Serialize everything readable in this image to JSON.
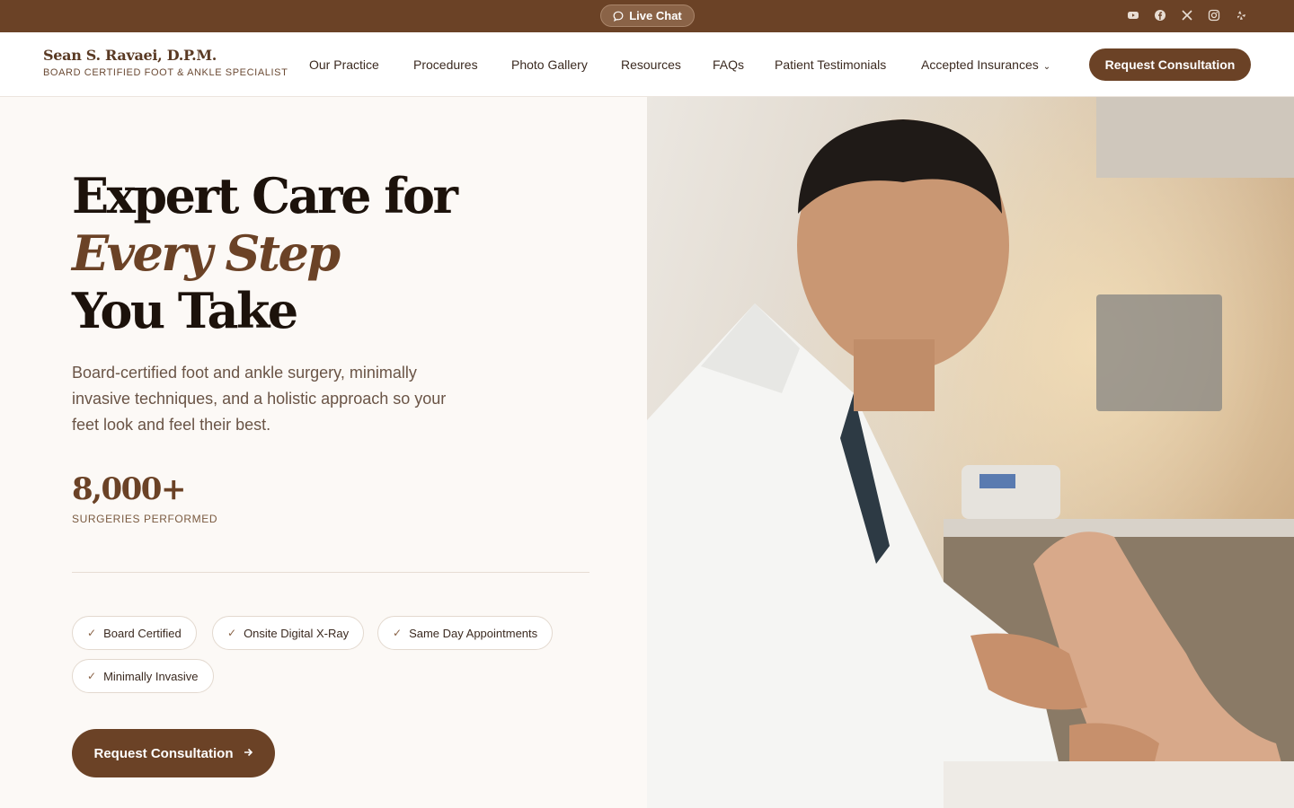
{
  "topbar": {
    "live_chat_label": "Live Chat",
    "socials": [
      "youtube-icon",
      "facebook-icon",
      "x-icon",
      "instagram-icon",
      "yelp-icon"
    ]
  },
  "brand": {
    "name": "Sean S. Ravaei, D.P.M.",
    "subtitle": "BOARD CERTIFIED FOOT & ANKLE SPECIALIST"
  },
  "nav": {
    "items": [
      "Our Practice",
      "Procedures",
      "Photo Gallery",
      "Resources",
      "FAQs",
      "Patient Testimonials",
      "Accepted Insurances"
    ],
    "cta_label": "Request Consultation"
  },
  "hero": {
    "title_line1": "Expert Care for",
    "title_accent": "Every Step",
    "title_line3": "You Take",
    "description": "Board-certified foot and ankle surgery, minimally invasive techniques, and a holistic approach so your feet look and feel their best.",
    "stat_value": "8,000+",
    "stat_label": "SURGERIES PERFORMED",
    "badges": [
      "Board Certified",
      "Onsite Digital X-Ray",
      "Same Day Appointments",
      "Minimally Invasive"
    ],
    "cta_label": "Request Consultation"
  },
  "colors": {
    "brand_brown": "#6b4226",
    "background": "#fcf9f6"
  }
}
